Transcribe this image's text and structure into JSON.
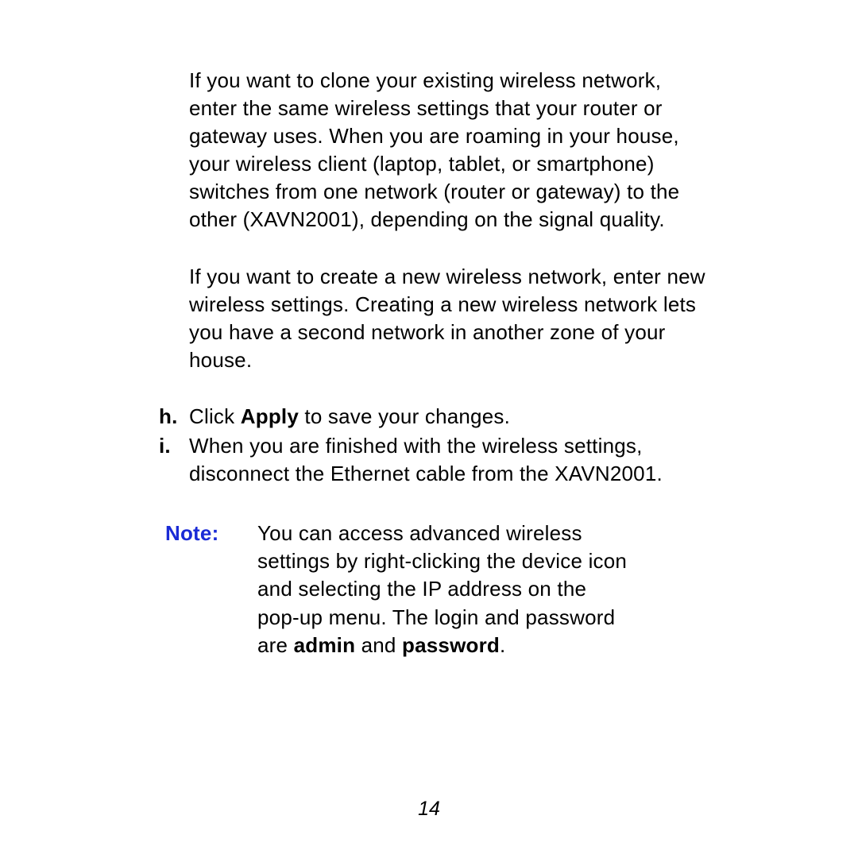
{
  "paragraphs": {
    "p1": "If you want to clone your existing wireless network, enter the same wireless settings that your router or gateway uses. When you are roaming in your house, your wireless client (laptop, tablet, or smartphone) switches from one network (router or gateway) to the other (XAVN2001), depending on the signal quality.",
    "p2": "If you want to create a new wireless network, enter new wireless settings. Creating a new wireless network lets you have a second network in another zone of your house."
  },
  "list": {
    "h": {
      "marker": "h.",
      "pre": "Click ",
      "bold": "Apply",
      "post": " to save your changes."
    },
    "i": {
      "marker": "i.",
      "text": "When you are finished with the wireless settings, disconnect the Ethernet cable from the XAVN2001."
    }
  },
  "note": {
    "label": "Note:  ",
    "pre": "You can access advanced wireless settings by right-clicking the device icon and selecting the IP address on the pop-up menu. The login and password are ",
    "bold1": "admin",
    "mid": " and ",
    "bold2": "password",
    "post": "."
  },
  "page_number": "14"
}
